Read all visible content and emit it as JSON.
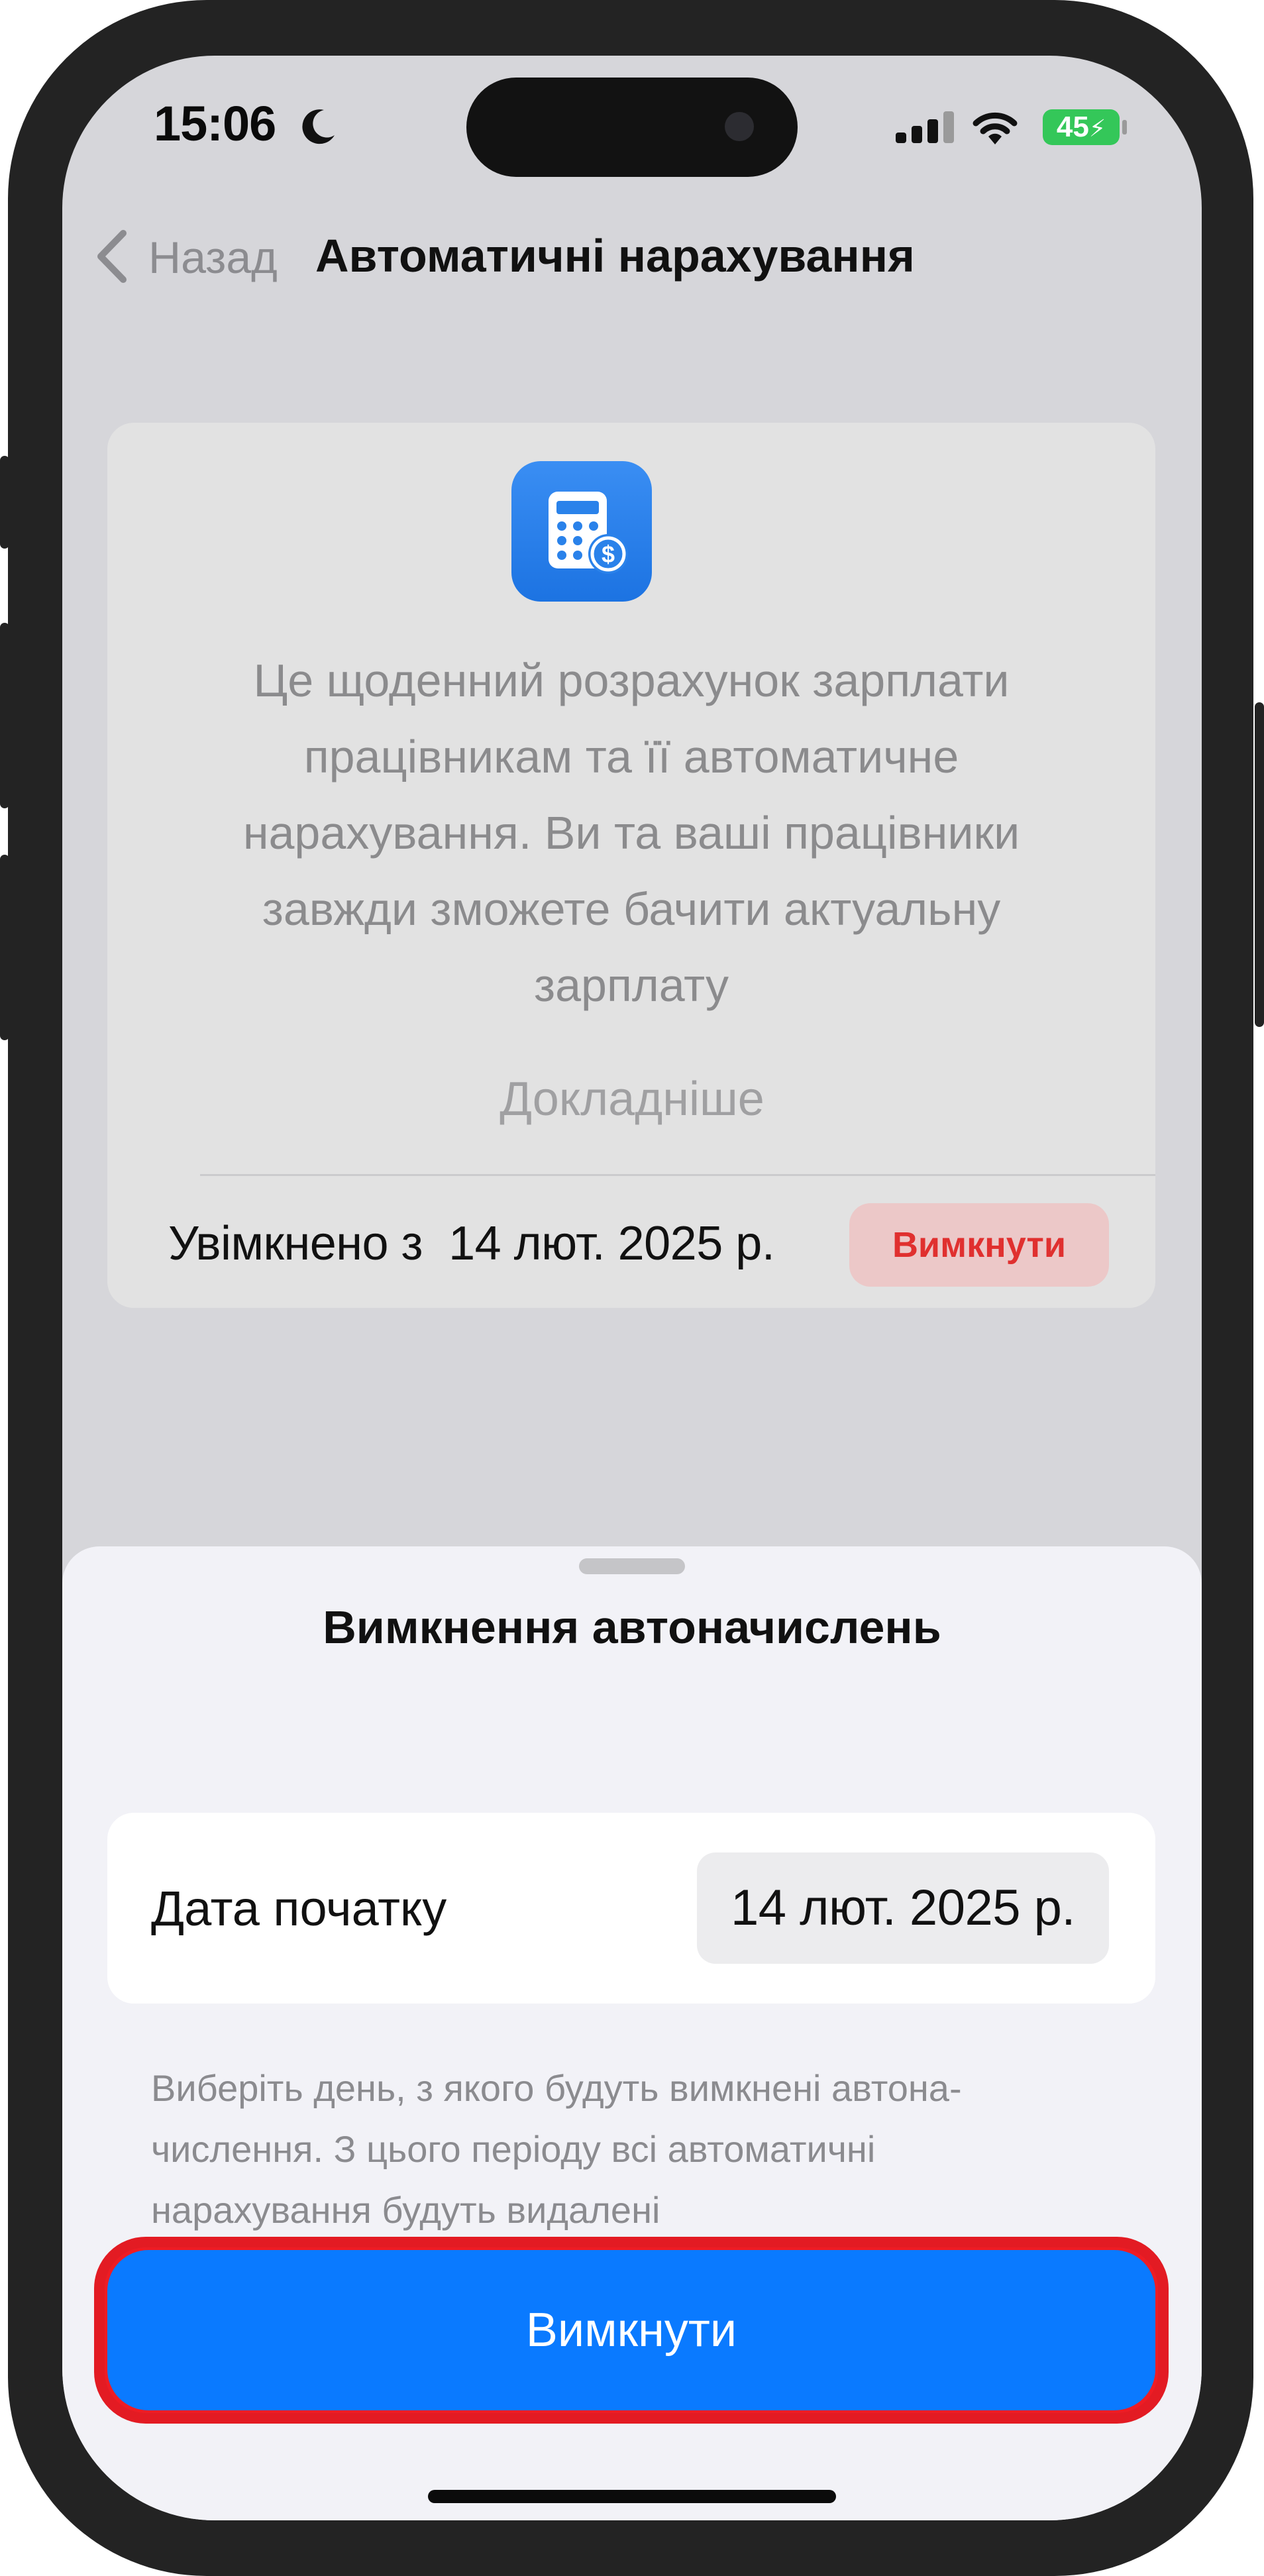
{
  "status_bar": {
    "time": "15:06",
    "battery": "45",
    "icons": [
      "moon-icon",
      "cellular-signal-icon",
      "wifi-icon",
      "battery-icon"
    ]
  },
  "nav": {
    "back_label": "Назад",
    "title": "Автоматичні нарахування"
  },
  "info_card": {
    "icon": "calculator-dollar-icon",
    "description": "Це щоденний розрахунок зарплати працівникам та її автоматичне нарахування. Ви та ваші працівники завжди зможете бачити актуальну зарплату",
    "learn_more": "Докладніше",
    "enabled_text": "Увімкнено з  14 лют. 2025 р.",
    "disable_label": "Вимкнути"
  },
  "sheet": {
    "title": "Вимкнення автоначислень",
    "start_date_label": "Дата початку",
    "start_date_value": "14 лют. 2025 р.",
    "help_text": "Виберіть день, з якого будуть вимкнені автона­числення. З цього періоду всі автоматичні нарахування будуть видалені",
    "confirm_label": "Вимкнути"
  },
  "colors": {
    "accent": "#0a7aff",
    "destructive": "#e0302f",
    "highlight": "#e31b23",
    "battery": "#34c759"
  }
}
